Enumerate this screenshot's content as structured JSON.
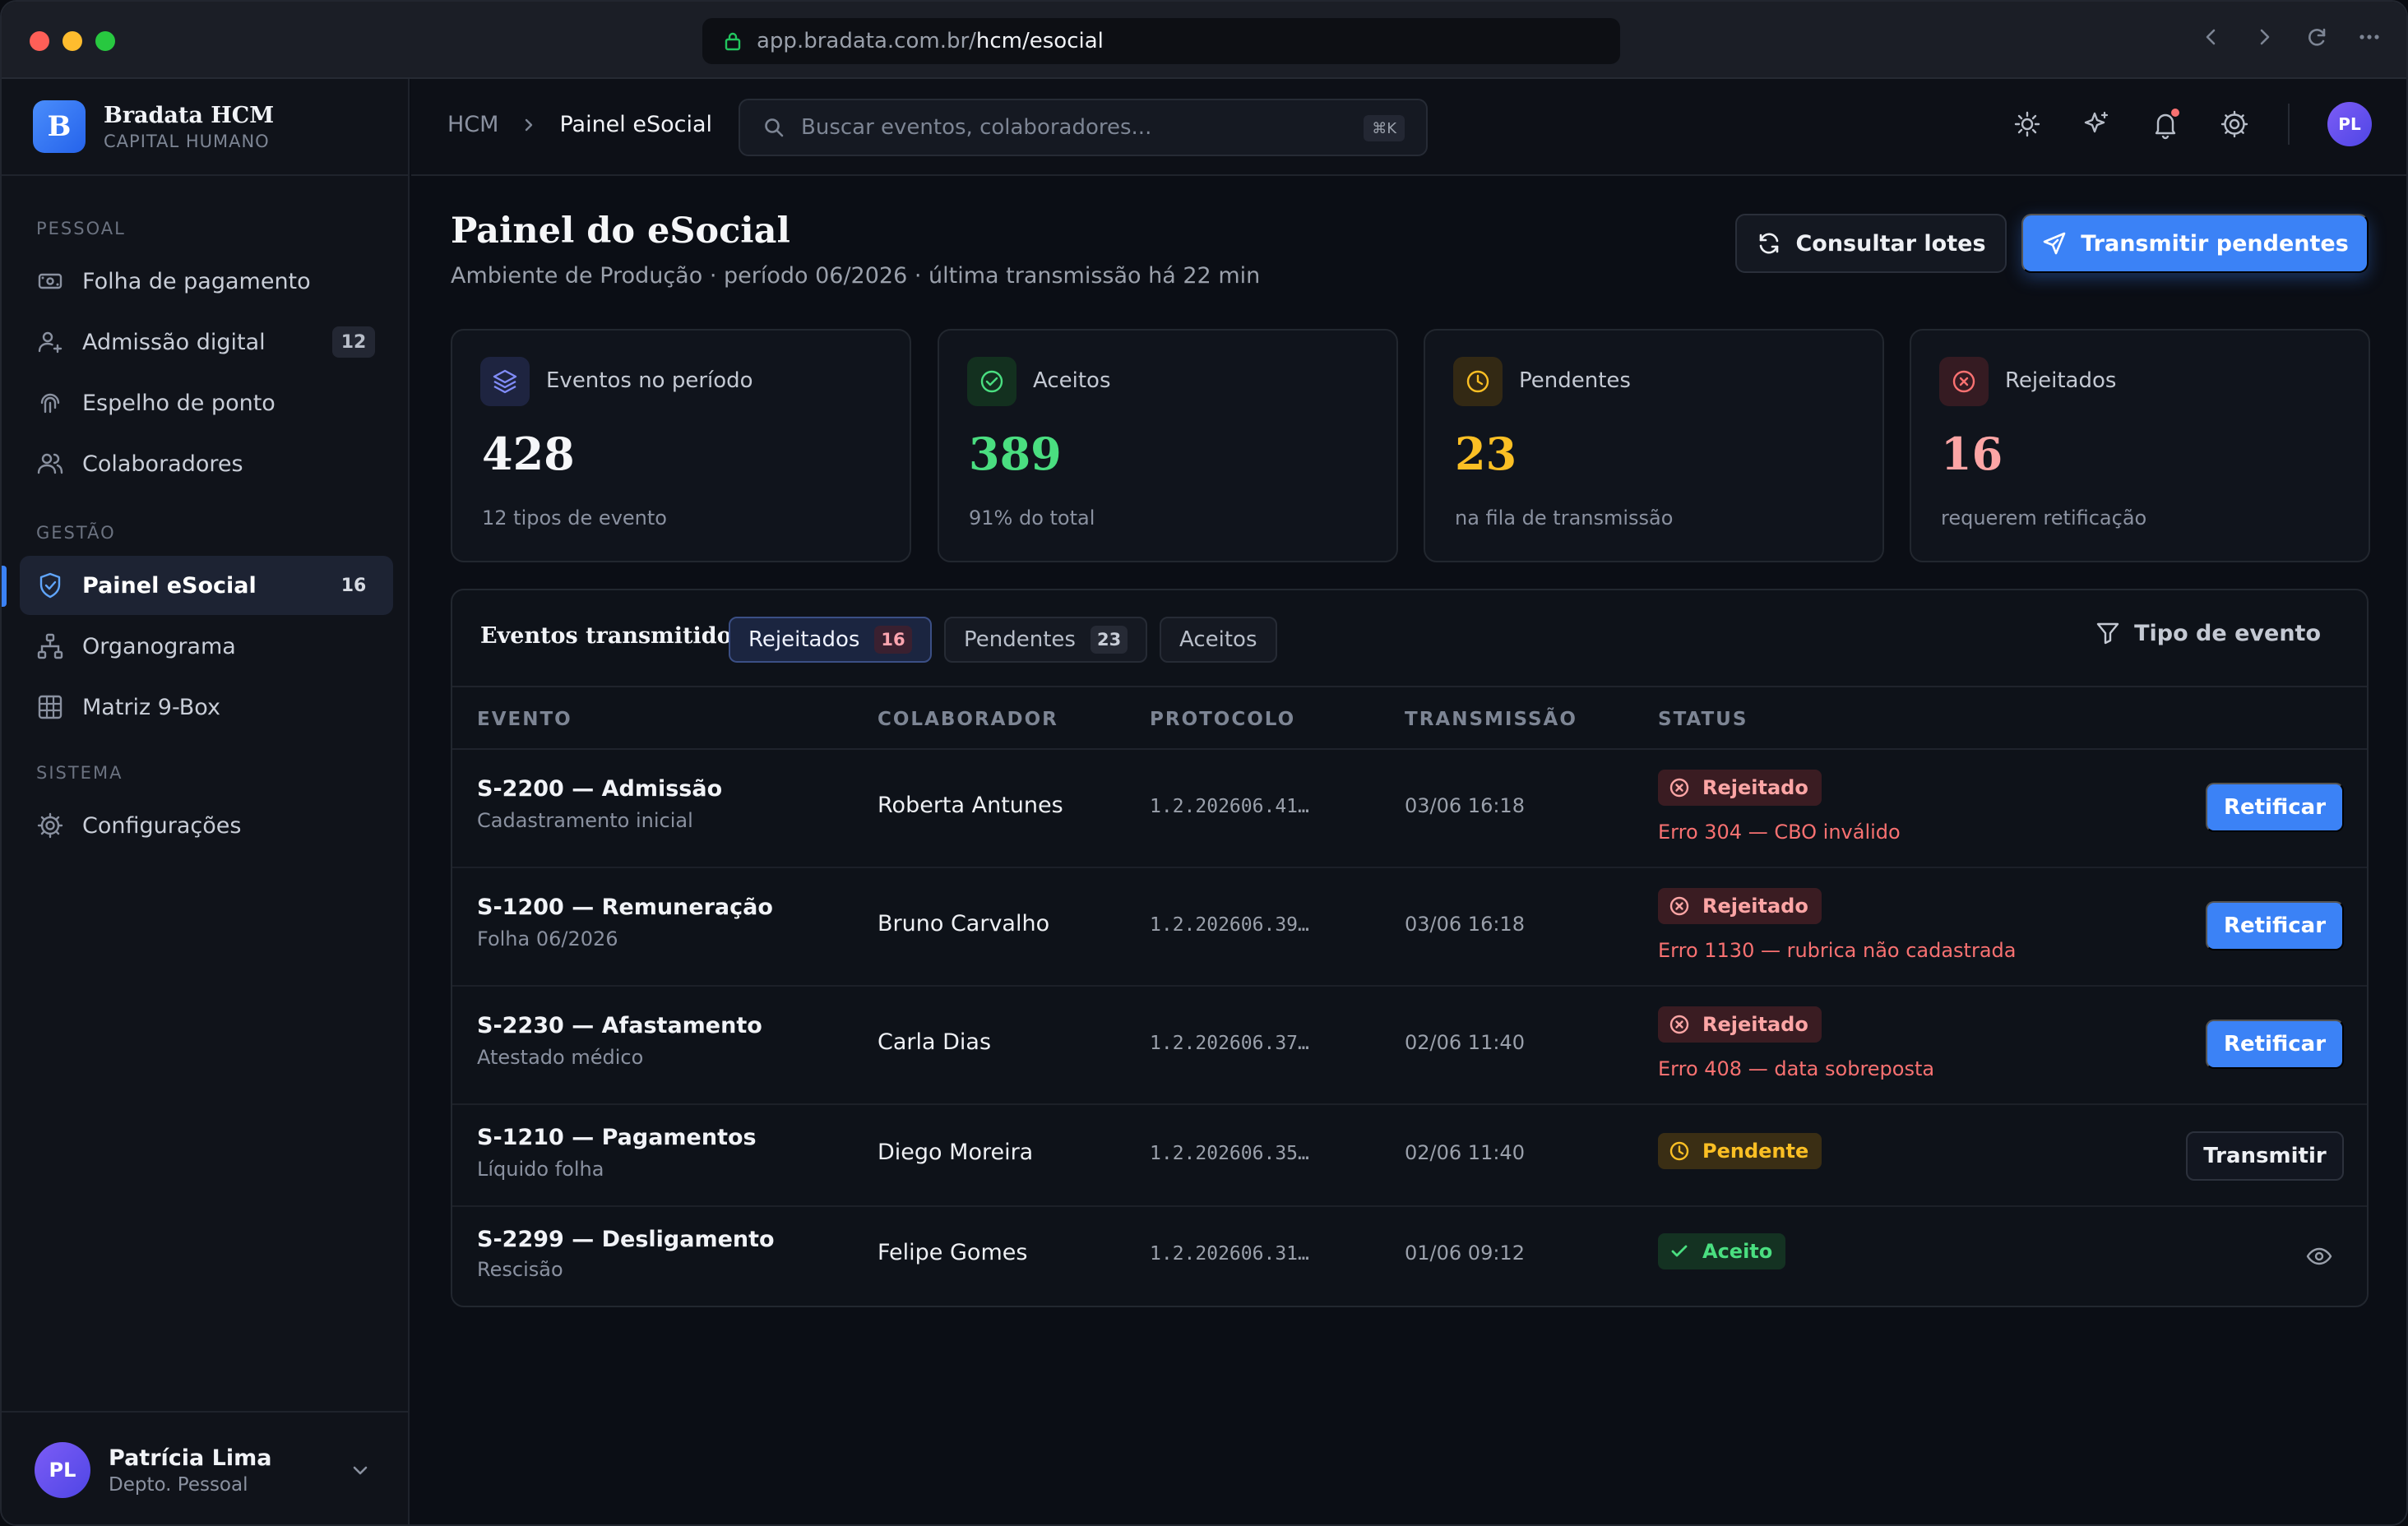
{
  "browser": {
    "url_host": "app.bradata.com.br/",
    "url_path": "hcm/esocial"
  },
  "brand": {
    "name": "Bradata HCM",
    "subtitle": "CAPITAL HUMANO",
    "logo_letter": "B"
  },
  "sidebar": {
    "sections": [
      {
        "label": "PESSOAL"
      },
      {
        "label": "GESTÃO"
      },
      {
        "label": "SISTEMA"
      }
    ],
    "items": [
      {
        "label": "Folha de pagamento",
        "icon": "payroll-icon"
      },
      {
        "label": "Admissão digital",
        "icon": "user-plus-icon",
        "count": "12"
      },
      {
        "label": "Espelho de ponto",
        "icon": "fingerprint-icon"
      },
      {
        "label": "Colaboradores",
        "icon": "users-icon"
      },
      {
        "label": "Painel eSocial",
        "icon": "shield-check-icon",
        "count": "16",
        "active": true
      },
      {
        "label": "Organograma",
        "icon": "org-chart-icon"
      },
      {
        "label": "Matriz 9-Box",
        "icon": "grid-icon"
      },
      {
        "label": "Configurações",
        "icon": "gear-icon"
      }
    ],
    "user": {
      "initials": "PL",
      "name": "Patrícia Lima",
      "role": "Depto. Pessoal"
    }
  },
  "topbar": {
    "breadcrumb": [
      "HCM",
      "Painel eSocial"
    ],
    "search_placeholder": "Buscar eventos, colaboradores...",
    "search_shortcut": "⌘K",
    "avatar_initials": "PL"
  },
  "page": {
    "title": "Painel do eSocial",
    "subtitle": "Ambiente de Produção · período 06/2026 · última transmissão há 22 min",
    "btn_consult": "Consultar lotes",
    "btn_transmit": "Transmitir pendentes"
  },
  "stats": [
    {
      "label": "Eventos no período",
      "value": "428",
      "note": "12 tipos de evento",
      "color": "#f5f6f8",
      "icon": "layers-icon"
    },
    {
      "label": "Aceitos",
      "value": "389",
      "note": "91% do total",
      "color": "#4ade80",
      "icon": "check-circle-icon"
    },
    {
      "label": "Pendentes",
      "value": "23",
      "note": "na fila de transmissão",
      "color": "#fbbf24",
      "icon": "clock-icon"
    },
    {
      "label": "Rejeitados",
      "value": "16",
      "note": "requerem retificação",
      "color": "#f87171",
      "icon": "x-circle-icon"
    }
  ],
  "panel": {
    "title": "Eventos transmitidos",
    "tabs": [
      {
        "label": "Rejeitados",
        "count": "16",
        "active": true
      },
      {
        "label": "Pendentes",
        "count": "23"
      },
      {
        "label": "Aceitos"
      }
    ],
    "filter_label": "Tipo de evento",
    "columns": [
      "EVENTO",
      "COLABORADOR",
      "PROTOCOLO",
      "TRANSMISSÃO",
      "STATUS"
    ],
    "rows": [
      {
        "event": "S-2200 — Admissão",
        "desc": "Cadastramento inicial",
        "colab": "Roberta Antunes",
        "protocol": "1.2.202606.41…",
        "time": "03/06 16:18",
        "status": "Rejeitado",
        "error": "Erro 304 — CBO inválido",
        "action": "Retificar"
      },
      {
        "event": "S-1200 — Remuneração",
        "desc": "Folha 06/2026",
        "colab": "Bruno Carvalho",
        "protocol": "1.2.202606.39…",
        "time": "03/06 16:18",
        "status": "Rejeitado",
        "error": "Erro 1130 — rubrica não cadastrada",
        "action": "Retificar"
      },
      {
        "event": "S-2230 — Afastamento",
        "desc": "Atestado médico",
        "colab": "Carla Dias",
        "protocol": "1.2.202606.37…",
        "time": "02/06 11:40",
        "status": "Rejeitado",
        "error": "Erro 408 — data sobreposta",
        "action": "Retificar"
      },
      {
        "event": "S-1210 — Pagamentos",
        "desc": "Líquido folha",
        "colab": "Diego Moreira",
        "protocol": "1.2.202606.35…",
        "time": "02/06 11:40",
        "status": "Pendente",
        "action": "Transmitir"
      },
      {
        "event": "S-2299 — Desligamento",
        "desc": "Rescisão",
        "colab": "Felipe Gomes",
        "protocol": "1.2.202606.31…",
        "time": "01/06 09:12",
        "status": "Aceito",
        "action_icon": "eye-icon"
      }
    ]
  }
}
